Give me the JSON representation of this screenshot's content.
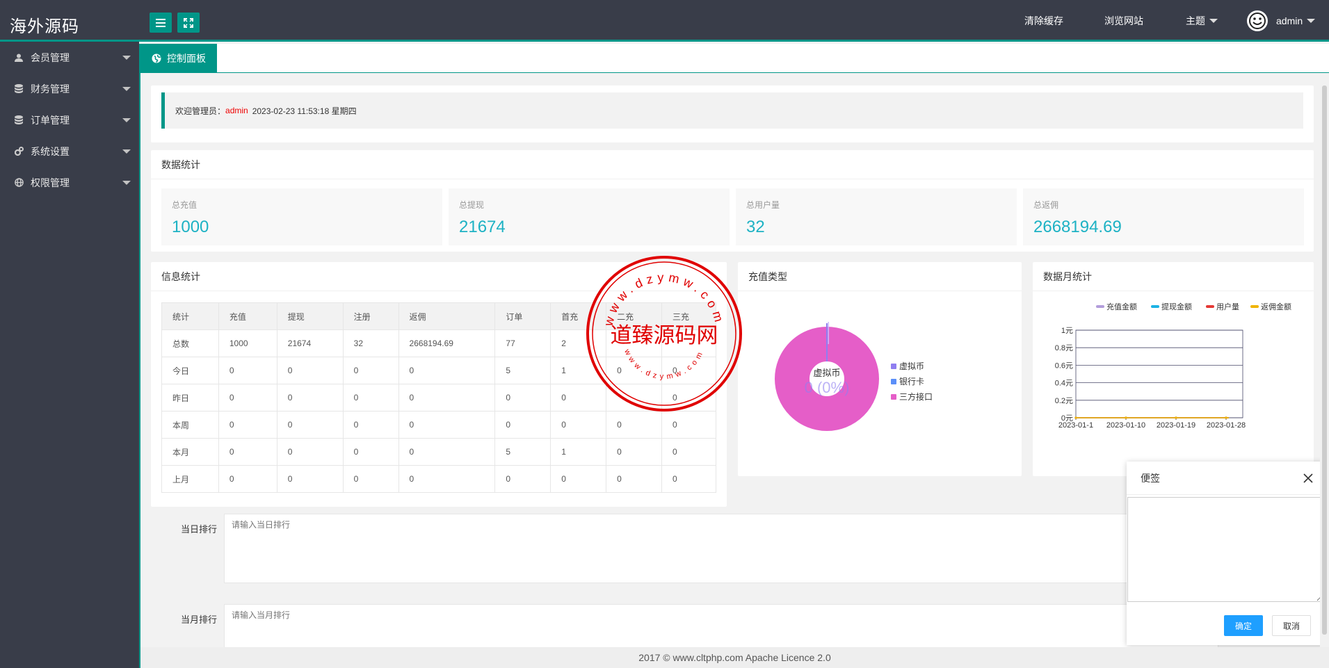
{
  "header": {
    "logo": "海外源码",
    "clear_cache": "清除缓存",
    "browse_site": "浏览网站",
    "theme": "主题",
    "user": "admin"
  },
  "sidebar": {
    "items": [
      {
        "label": "会员管理",
        "icon": "user-icon"
      },
      {
        "label": "财务管理",
        "icon": "database-icon"
      },
      {
        "label": "订单管理",
        "icon": "database-icon"
      },
      {
        "label": "系统设置",
        "icon": "gears-icon"
      },
      {
        "label": "权限管理",
        "icon": "globe-icon"
      }
    ]
  },
  "tabs": [
    {
      "label": "控制面板",
      "icon": "globe-icon",
      "active": true
    }
  ],
  "welcome": {
    "prefix": "欢迎管理员：",
    "user": "admin",
    "datetime": "2023-02-23  11:53:18  星期四"
  },
  "stats": {
    "title": "数据统计",
    "items": [
      {
        "label": "总充值",
        "value": "1000"
      },
      {
        "label": "总提现",
        "value": "21674"
      },
      {
        "label": "总用户量",
        "value": "32"
      },
      {
        "label": "总返佣",
        "value": "2668194.69"
      }
    ]
  },
  "info": {
    "title": "信息统计",
    "headers": [
      "统计",
      "充值",
      "提现",
      "注册",
      "返佣",
      "订单",
      "首充",
      "二充",
      "三充"
    ],
    "rows": [
      [
        "总数",
        "1000",
        "21674",
        "32",
        "2668194.69",
        "77",
        "2",
        "",
        ""
      ],
      [
        "今日",
        "0",
        "0",
        "0",
        "0",
        "5",
        "1",
        "0",
        "0"
      ],
      [
        "昨日",
        "0",
        "0",
        "0",
        "0",
        "0",
        "0",
        "",
        "0"
      ],
      [
        "本周",
        "0",
        "0",
        "0",
        "0",
        "0",
        "0",
        "0",
        "0"
      ],
      [
        "本月",
        "0",
        "0",
        "0",
        "0",
        "5",
        "1",
        "0",
        "0"
      ],
      [
        "上月",
        "0",
        "0",
        "0",
        "0",
        "0",
        "0",
        "0",
        "0"
      ]
    ]
  },
  "pie": {
    "title": "充值类型",
    "center_label": "虚拟币",
    "center_value": "0 (0%)",
    "legend": [
      {
        "name": "虚拟币",
        "color": "#8f7ef0"
      },
      {
        "name": "银行卡",
        "color": "#5b8ff9"
      },
      {
        "name": "三方接口",
        "color": "#e55ec8"
      }
    ]
  },
  "chart_data": {
    "type": "line",
    "title": "数据月统计",
    "x": [
      "2023-01-1",
      "2023-01-10",
      "2023-01-19",
      "2023-01-28"
    ],
    "series": [
      {
        "name": "充值金额",
        "color": "#b39ddb",
        "values": [
          0,
          0,
          0,
          0
        ]
      },
      {
        "name": "提现金额",
        "color": "#1db2e4",
        "values": [
          0,
          0,
          0,
          0
        ]
      },
      {
        "name": "用户量",
        "color": "#e53935",
        "values": [
          0,
          0,
          0,
          0
        ]
      },
      {
        "name": "返佣金额",
        "color": "#f0b400",
        "values": [
          0,
          0,
          0,
          0
        ]
      }
    ],
    "ylim": [
      0,
      1
    ],
    "yticks": [
      "0元",
      "0.2元",
      "0.4元",
      "0.6元",
      "0.8元",
      "1元"
    ],
    "legend_position": "top-right"
  },
  "form": {
    "daily_label": "当日排行",
    "daily_placeholder": "请输入当日排行",
    "monthly_label": "当月排行",
    "monthly_placeholder": "请输入当月排行"
  },
  "watermark": {
    "text": "道臻源码网",
    "url_top": "www.dzymw.com",
    "url_bottom": "www.dzymw.com",
    "color": "#e00000"
  },
  "memo": {
    "title": "便签",
    "ok": "确定",
    "cancel": "取消"
  },
  "footer": {
    "text": "2017 ©  www.cltphp.com  Apache Licence 2.0"
  }
}
